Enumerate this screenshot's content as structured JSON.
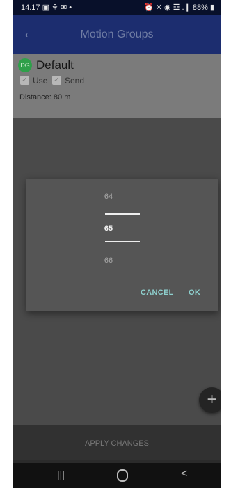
{
  "status_bar": {
    "time": "14.17 ▣ ⚘ ✉ •",
    "right": "⏰ ✕ ◉ ☲ .❙ 88% ▮"
  },
  "app_bar": {
    "back_icon": "←",
    "title": "Motion Groups"
  },
  "group": {
    "avatar": "DG",
    "name": "Default",
    "use_label": "Use",
    "send_label": "Send",
    "use_checked": true,
    "send_checked": true,
    "check_glyph": "✓",
    "distance": "Distance: 80 m"
  },
  "picker_dialog": {
    "previous": "64",
    "current": "65",
    "next": "66",
    "cancel_label": "CANCEL",
    "ok_label": "OK"
  },
  "fab": {
    "icon": "+"
  },
  "apply": {
    "label": "APPLY CHANGES"
  },
  "nav_bar": {
    "recents": "|||",
    "home": "O",
    "back": "<"
  },
  "colors": {
    "app_bar": "#1c2d6f",
    "accent": "#8ed0ce",
    "avatar": "#2fa04a"
  }
}
